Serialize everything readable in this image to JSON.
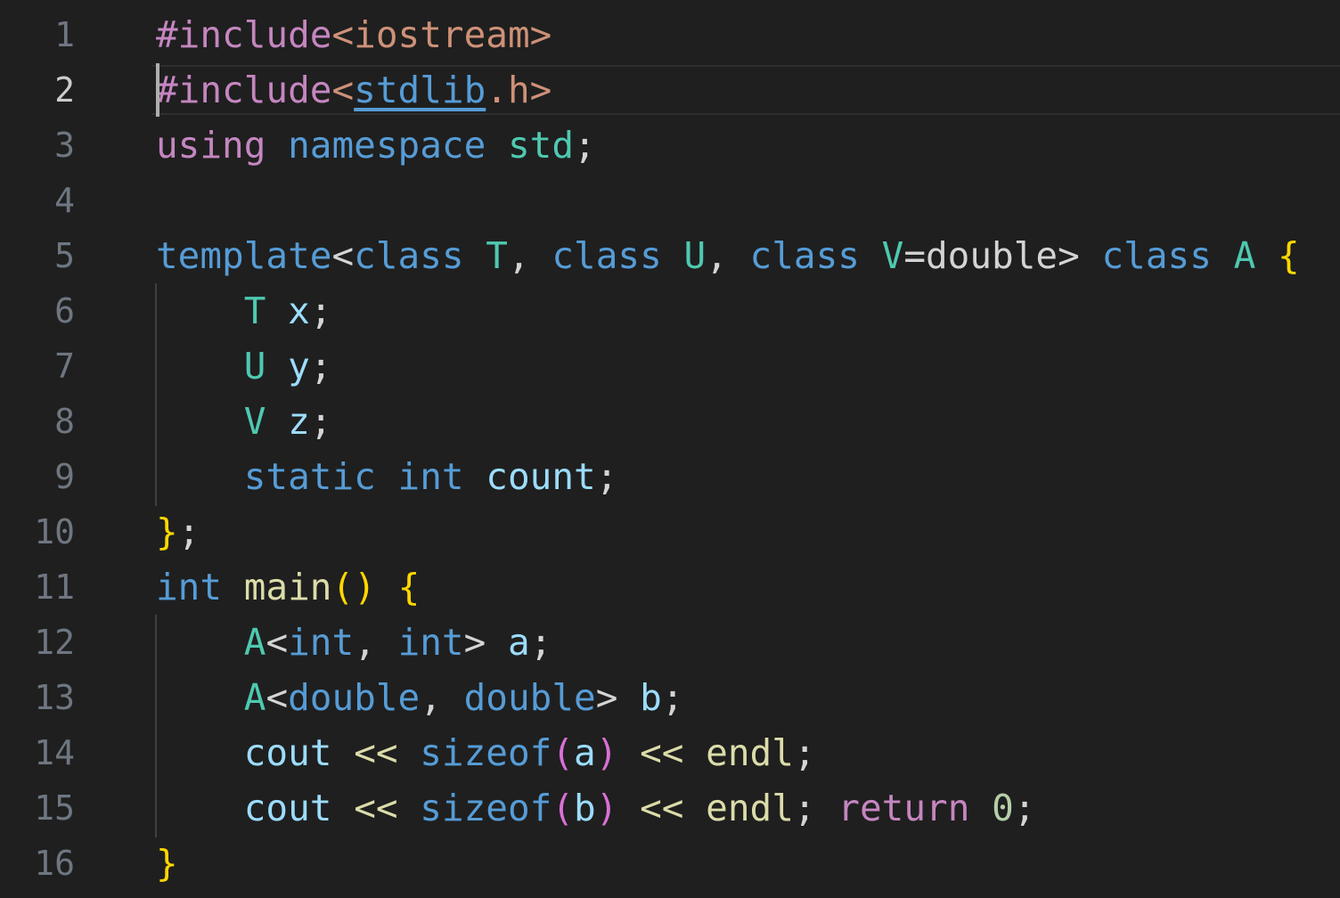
{
  "editor": {
    "theme": {
      "background": "#1f1f1f",
      "line_number": "#6e7681",
      "line_number_active": "#cccccc",
      "preprocessor": "#c586c0",
      "string": "#ce9178",
      "keyword": "#569cd6",
      "type": "#4ec9b0",
      "variable": "#9cdcfe",
      "function": "#dcdcaa",
      "control": "#c586c0",
      "number": "#b5cea8",
      "bracket_gold": "#ffd700",
      "bracket_purple": "#da70d6",
      "default": "#d4d4d4"
    },
    "active_line": 2,
    "lines": [
      {
        "number": "1",
        "tokens": [
          {
            "text": "#include",
            "color": "#c586c0"
          },
          {
            "text": "<iostream>",
            "color": "#ce9178"
          }
        ]
      },
      {
        "number": "2",
        "tokens": [
          {
            "text": "#include",
            "color": "#c586c0"
          },
          {
            "text": "<",
            "color": "#ce9178"
          },
          {
            "text": "stdlib",
            "color": "#569cd6",
            "underline": true
          },
          {
            "text": ".h>",
            "color": "#ce9178"
          }
        ]
      },
      {
        "number": "3",
        "tokens": [
          {
            "text": "using",
            "color": "#c586c0"
          },
          {
            "text": " ",
            "color": "#d4d4d4"
          },
          {
            "text": "namespace",
            "color": "#569cd6"
          },
          {
            "text": " ",
            "color": "#d4d4d4"
          },
          {
            "text": "std",
            "color": "#4ec9b0"
          },
          {
            "text": ";",
            "color": "#d4d4d4"
          }
        ]
      },
      {
        "number": "4",
        "tokens": []
      },
      {
        "number": "5",
        "tokens": [
          {
            "text": "template",
            "color": "#569cd6"
          },
          {
            "text": "<",
            "color": "#d4d4d4"
          },
          {
            "text": "class",
            "color": "#569cd6"
          },
          {
            "text": " ",
            "color": "#d4d4d4"
          },
          {
            "text": "T",
            "color": "#4ec9b0"
          },
          {
            "text": ", ",
            "color": "#d4d4d4"
          },
          {
            "text": "class",
            "color": "#569cd6"
          },
          {
            "text": " ",
            "color": "#d4d4d4"
          },
          {
            "text": "U",
            "color": "#4ec9b0"
          },
          {
            "text": ", ",
            "color": "#d4d4d4"
          },
          {
            "text": "class",
            "color": "#569cd6"
          },
          {
            "text": " ",
            "color": "#d4d4d4"
          },
          {
            "text": "V",
            "color": "#4ec9b0"
          },
          {
            "text": "=double> ",
            "color": "#d4d4d4"
          },
          {
            "text": "class",
            "color": "#569cd6"
          },
          {
            "text": " ",
            "color": "#d4d4d4"
          },
          {
            "text": "A",
            "color": "#4ec9b0"
          },
          {
            "text": " ",
            "color": "#d4d4d4"
          },
          {
            "text": "{",
            "color": "#ffd700"
          }
        ]
      },
      {
        "number": "6",
        "tokens": [
          {
            "text": "    ",
            "color": "#d4d4d4"
          },
          {
            "text": "T",
            "color": "#4ec9b0"
          },
          {
            "text": " ",
            "color": "#d4d4d4"
          },
          {
            "text": "x",
            "color": "#9cdcfe"
          },
          {
            "text": ";",
            "color": "#d4d4d4"
          }
        ]
      },
      {
        "number": "7",
        "tokens": [
          {
            "text": "    ",
            "color": "#d4d4d4"
          },
          {
            "text": "U",
            "color": "#4ec9b0"
          },
          {
            "text": " ",
            "color": "#d4d4d4"
          },
          {
            "text": "y",
            "color": "#9cdcfe"
          },
          {
            "text": ";",
            "color": "#d4d4d4"
          }
        ]
      },
      {
        "number": "8",
        "tokens": [
          {
            "text": "    ",
            "color": "#d4d4d4"
          },
          {
            "text": "V",
            "color": "#4ec9b0"
          },
          {
            "text": " ",
            "color": "#d4d4d4"
          },
          {
            "text": "z",
            "color": "#9cdcfe"
          },
          {
            "text": ";",
            "color": "#d4d4d4"
          }
        ]
      },
      {
        "number": "9",
        "tokens": [
          {
            "text": "    ",
            "color": "#d4d4d4"
          },
          {
            "text": "static",
            "color": "#569cd6"
          },
          {
            "text": " ",
            "color": "#d4d4d4"
          },
          {
            "text": "int",
            "color": "#569cd6"
          },
          {
            "text": " ",
            "color": "#d4d4d4"
          },
          {
            "text": "count",
            "color": "#9cdcfe"
          },
          {
            "text": ";",
            "color": "#d4d4d4"
          }
        ]
      },
      {
        "number": "10",
        "tokens": [
          {
            "text": "}",
            "color": "#ffd700"
          },
          {
            "text": ";",
            "color": "#d4d4d4"
          }
        ]
      },
      {
        "number": "11",
        "tokens": [
          {
            "text": "int",
            "color": "#569cd6"
          },
          {
            "text": " ",
            "color": "#d4d4d4"
          },
          {
            "text": "main",
            "color": "#dcdcaa"
          },
          {
            "text": "()",
            "color": "#ffd700"
          },
          {
            "text": " ",
            "color": "#d4d4d4"
          },
          {
            "text": "{",
            "color": "#ffd700"
          }
        ]
      },
      {
        "number": "12",
        "tokens": [
          {
            "text": "    ",
            "color": "#d4d4d4"
          },
          {
            "text": "A",
            "color": "#4ec9b0"
          },
          {
            "text": "<",
            "color": "#d4d4d4"
          },
          {
            "text": "int",
            "color": "#569cd6"
          },
          {
            "text": ", ",
            "color": "#d4d4d4"
          },
          {
            "text": "int",
            "color": "#569cd6"
          },
          {
            "text": "> ",
            "color": "#d4d4d4"
          },
          {
            "text": "a",
            "color": "#9cdcfe"
          },
          {
            "text": ";",
            "color": "#d4d4d4"
          }
        ]
      },
      {
        "number": "13",
        "tokens": [
          {
            "text": "    ",
            "color": "#d4d4d4"
          },
          {
            "text": "A",
            "color": "#4ec9b0"
          },
          {
            "text": "<",
            "color": "#d4d4d4"
          },
          {
            "text": "double",
            "color": "#569cd6"
          },
          {
            "text": ", ",
            "color": "#d4d4d4"
          },
          {
            "text": "double",
            "color": "#569cd6"
          },
          {
            "text": "> ",
            "color": "#d4d4d4"
          },
          {
            "text": "b",
            "color": "#9cdcfe"
          },
          {
            "text": ";",
            "color": "#d4d4d4"
          }
        ]
      },
      {
        "number": "14",
        "tokens": [
          {
            "text": "    ",
            "color": "#d4d4d4"
          },
          {
            "text": "cout",
            "color": "#9cdcfe"
          },
          {
            "text": " ",
            "color": "#d4d4d4"
          },
          {
            "text": "<<",
            "color": "#dcdcaa"
          },
          {
            "text": " ",
            "color": "#d4d4d4"
          },
          {
            "text": "sizeof",
            "color": "#569cd6"
          },
          {
            "text": "(",
            "color": "#da70d6"
          },
          {
            "text": "a",
            "color": "#9cdcfe"
          },
          {
            "text": ")",
            "color": "#da70d6"
          },
          {
            "text": " ",
            "color": "#d4d4d4"
          },
          {
            "text": "<<",
            "color": "#dcdcaa"
          },
          {
            "text": " ",
            "color": "#d4d4d4"
          },
          {
            "text": "endl",
            "color": "#dcdcaa"
          },
          {
            "text": ";",
            "color": "#d4d4d4"
          }
        ]
      },
      {
        "number": "15",
        "tokens": [
          {
            "text": "    ",
            "color": "#d4d4d4"
          },
          {
            "text": "cout",
            "color": "#9cdcfe"
          },
          {
            "text": " ",
            "color": "#d4d4d4"
          },
          {
            "text": "<<",
            "color": "#dcdcaa"
          },
          {
            "text": " ",
            "color": "#d4d4d4"
          },
          {
            "text": "sizeof",
            "color": "#569cd6"
          },
          {
            "text": "(",
            "color": "#da70d6"
          },
          {
            "text": "b",
            "color": "#9cdcfe"
          },
          {
            "text": ")",
            "color": "#da70d6"
          },
          {
            "text": " ",
            "color": "#d4d4d4"
          },
          {
            "text": "<<",
            "color": "#dcdcaa"
          },
          {
            "text": " ",
            "color": "#d4d4d4"
          },
          {
            "text": "endl",
            "color": "#dcdcaa"
          },
          {
            "text": ";",
            "color": "#d4d4d4"
          },
          {
            "text": " ",
            "color": "#d4d4d4"
          },
          {
            "text": "return",
            "color": "#c586c0"
          },
          {
            "text": " ",
            "color": "#d4d4d4"
          },
          {
            "text": "0",
            "color": "#b5cea8"
          },
          {
            "text": ";",
            "color": "#d4d4d4"
          }
        ]
      },
      {
        "number": "16",
        "tokens": [
          {
            "text": "}",
            "color": "#ffd700"
          }
        ]
      }
    ]
  }
}
